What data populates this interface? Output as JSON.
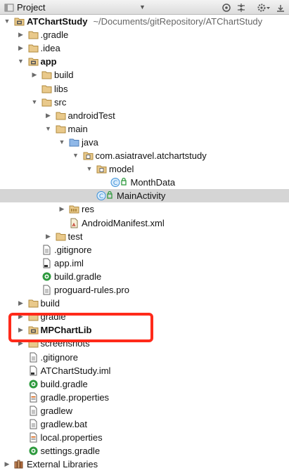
{
  "header": {
    "title": "Project",
    "dropdown_icon": "chevron-down-icon",
    "buttons": [
      "target-icon",
      "collapse-icon",
      "gear-icon",
      "hide-icon"
    ]
  },
  "tree": [
    {
      "label": "ATChartStudy",
      "path": "~/Documents/gitRepository/ATChartStudy",
      "bold": true,
      "icon": "module",
      "arrow": "down",
      "depth": 0
    },
    {
      "label": ".gradle",
      "icon": "folder",
      "arrow": "right",
      "depth": 1
    },
    {
      "label": ".idea",
      "icon": "folder",
      "arrow": "right",
      "depth": 1
    },
    {
      "label": "app",
      "bold": true,
      "icon": "module",
      "arrow": "down",
      "depth": 1
    },
    {
      "label": "build",
      "icon": "folder",
      "arrow": "right",
      "depth": 2
    },
    {
      "label": "libs",
      "icon": "folder",
      "arrow": "none",
      "depth": 2
    },
    {
      "label": "src",
      "icon": "folder",
      "arrow": "down",
      "depth": 2
    },
    {
      "label": "androidTest",
      "icon": "folder",
      "arrow": "right",
      "depth": 3
    },
    {
      "label": "main",
      "icon": "folder",
      "arrow": "down",
      "depth": 3
    },
    {
      "label": "java",
      "icon": "folder-source",
      "arrow": "down",
      "depth": 4
    },
    {
      "label": "com.asiatravel.atchartstudy",
      "icon": "package",
      "arrow": "down",
      "depth": 5
    },
    {
      "label": "model",
      "icon": "package",
      "arrow": "down",
      "depth": 6
    },
    {
      "label": "MonthData",
      "icon": "class",
      "arrow": "none",
      "depth": 7
    },
    {
      "label": "MainActivity",
      "icon": "class",
      "arrow": "none",
      "depth": 6,
      "selected": true
    },
    {
      "label": "res",
      "icon": "folder-res",
      "arrow": "right",
      "depth": 4
    },
    {
      "label": "AndroidManifest.xml",
      "icon": "manifest",
      "arrow": "none",
      "depth": 4
    },
    {
      "label": "test",
      "icon": "folder",
      "arrow": "right",
      "depth": 3
    },
    {
      "label": ".gitignore",
      "icon": "file",
      "arrow": "none",
      "depth": 2
    },
    {
      "label": "app.iml",
      "icon": "file-iml",
      "arrow": "none",
      "depth": 2
    },
    {
      "label": "build.gradle",
      "icon": "gradle",
      "arrow": "none",
      "depth": 2
    },
    {
      "label": "proguard-rules.pro",
      "icon": "file",
      "arrow": "none",
      "depth": 2
    },
    {
      "label": "build",
      "icon": "folder",
      "arrow": "right",
      "depth": 1
    },
    {
      "label": "gradle",
      "icon": "folder",
      "arrow": "right",
      "depth": 1
    },
    {
      "label": "MPChartLib",
      "bold": true,
      "icon": "module",
      "arrow": "right",
      "depth": 1
    },
    {
      "label": "screenshots",
      "icon": "folder",
      "arrow": "right",
      "depth": 1
    },
    {
      "label": ".gitignore",
      "icon": "file",
      "arrow": "none",
      "depth": 1
    },
    {
      "label": "ATChartStudy.iml",
      "icon": "file-iml",
      "arrow": "none",
      "depth": 1
    },
    {
      "label": "build.gradle",
      "icon": "gradle",
      "arrow": "none",
      "depth": 1
    },
    {
      "label": "gradle.properties",
      "icon": "properties",
      "arrow": "none",
      "depth": 1
    },
    {
      "label": "gradlew",
      "icon": "file",
      "arrow": "none",
      "depth": 1
    },
    {
      "label": "gradlew.bat",
      "icon": "file",
      "arrow": "none",
      "depth": 1
    },
    {
      "label": "local.properties",
      "icon": "properties",
      "arrow": "none",
      "depth": 1
    },
    {
      "label": "settings.gradle",
      "icon": "gradle",
      "arrow": "none",
      "depth": 1
    },
    {
      "label": "External Libraries",
      "icon": "libraries",
      "arrow": "right",
      "depth": 0
    }
  ],
  "colors": {
    "selection": "#d5d5d5",
    "folder": "#d8a657",
    "highlight": "#ff2a1a",
    "class": "#3a8fd8",
    "gradle": "#2e9a3e"
  }
}
